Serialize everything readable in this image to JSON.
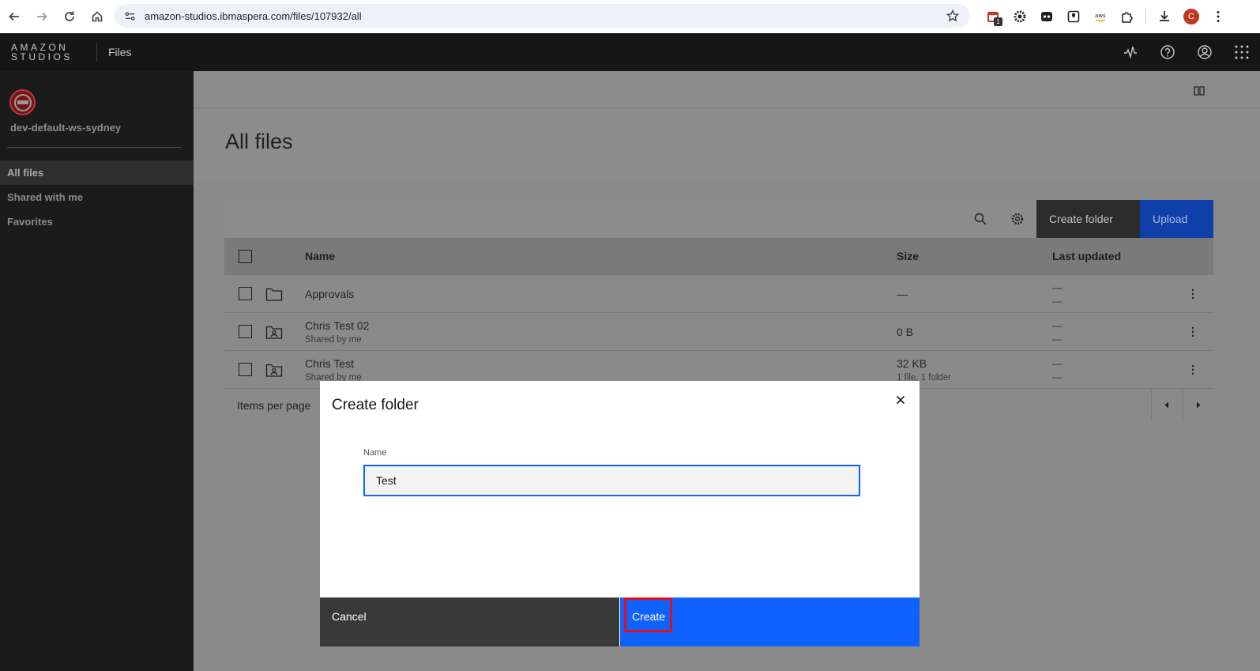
{
  "browser": {
    "url": "amazon-studios.ibmaspera.com/files/107932/all",
    "extension_badge": "1",
    "profile_initial": "C",
    "icons": [
      "back-icon",
      "forward-icon",
      "reload-icon",
      "home-icon",
      "site-info-icon",
      "star-icon",
      "ext-calendar-icon",
      "ext-gear-icon",
      "ext-ghost-icon",
      "ext-shield-icon",
      "ext-amazon-icon",
      "ext-puzzle-icon",
      "download-icon",
      "profile-avatar",
      "kebab-menu-icon"
    ]
  },
  "app_header": {
    "logo_line1": "AMAZON",
    "logo_line2": "STUDIOS",
    "title": "Files",
    "icons": [
      "activity-icon",
      "help-icon",
      "user-icon",
      "app-switcher-icon"
    ]
  },
  "sidebar": {
    "workspace_name": "dev-default-ws-sydney",
    "items": [
      {
        "label": "All files",
        "active": true
      },
      {
        "label": "Shared with me",
        "active": false
      },
      {
        "label": "Favorites",
        "active": false
      }
    ]
  },
  "main": {
    "page_title": "All files",
    "toolbar": {
      "create_folder_label": "Create folder",
      "upload_label": "Upload"
    },
    "table": {
      "columns": [
        "Name",
        "Size",
        "Last updated"
      ],
      "rows": [
        {
          "name": "Approvals",
          "sub": "",
          "size": "—",
          "size_sub": "",
          "updated1": "—",
          "updated2": "—",
          "icon": "folder-icon"
        },
        {
          "name": "Chris Test 02",
          "sub": "Shared by me",
          "size": "0 B",
          "size_sub": "",
          "updated1": "—",
          "updated2": "—",
          "icon": "shared-folder-icon"
        },
        {
          "name": "Chris Test",
          "sub": "Shared by me",
          "size": "32 KB",
          "size_sub": "1 file, 1 folder",
          "updated1": "—",
          "updated2": "—",
          "icon": "shared-folder-icon"
        }
      ]
    },
    "pagination": {
      "items_per_page_label": "Items per page"
    }
  },
  "modal": {
    "title": "Create folder",
    "name_label": "Name",
    "name_value": "Test",
    "cancel_label": "Cancel",
    "create_label": "Create"
  },
  "colors": {
    "primary": "#0f62fe",
    "header_bg": "#161616",
    "sidebar_bg": "#1b1b1b",
    "highlight": "#e0101a"
  }
}
